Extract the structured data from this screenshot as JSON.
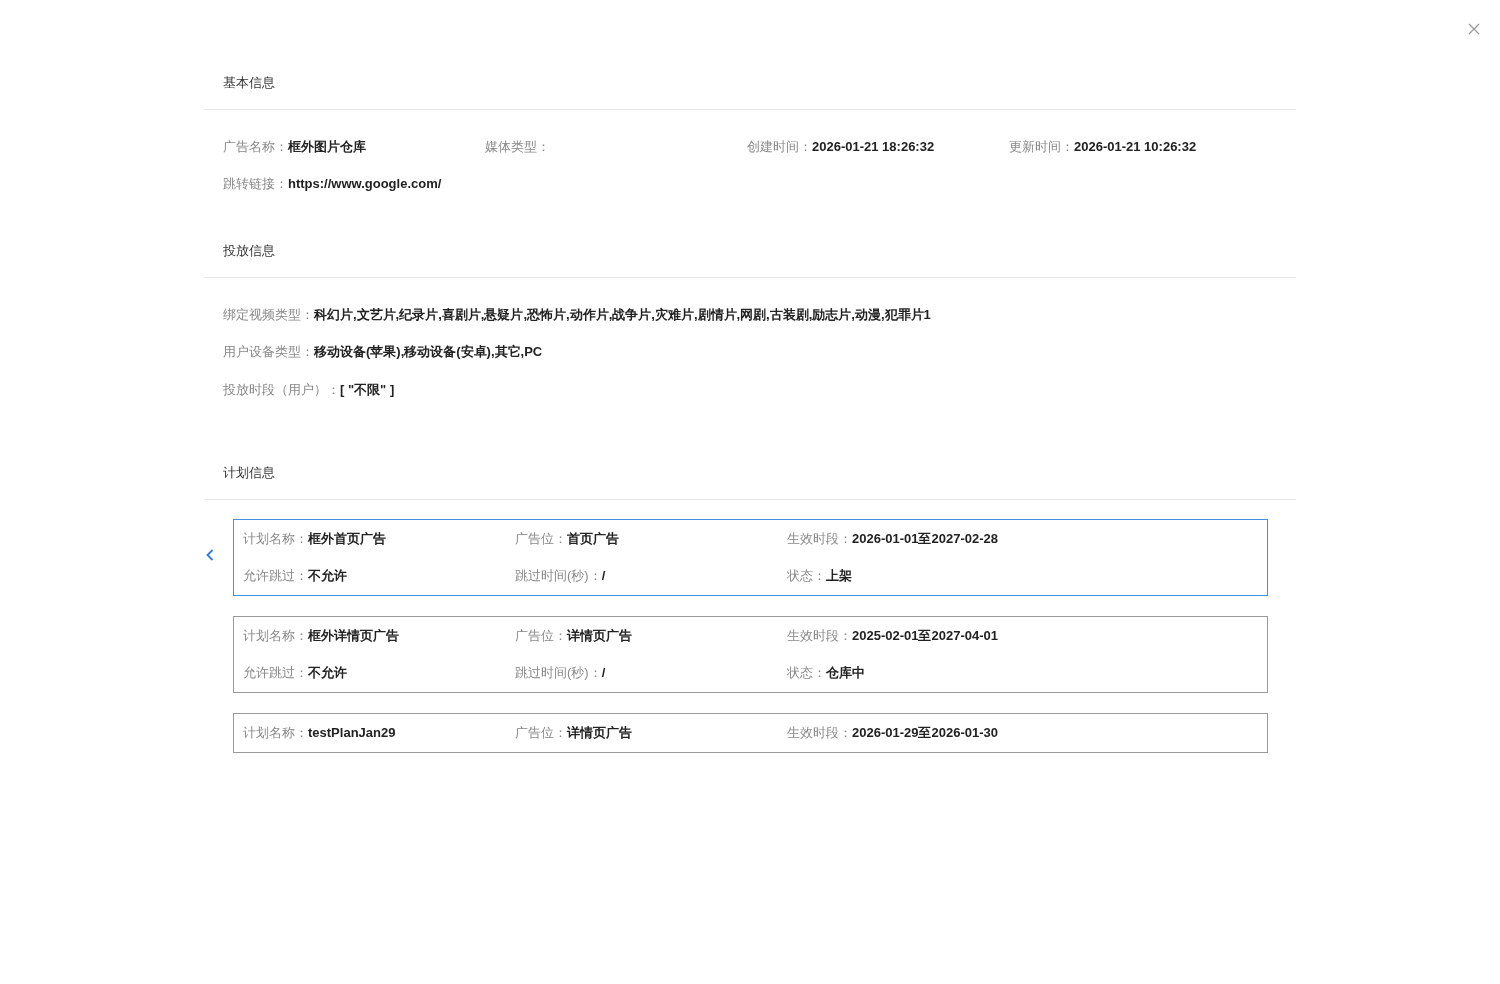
{
  "sections": [
    {
      "title": "基本信息",
      "kind": "fields",
      "rows": [
        [
          {
            "label": "广告名称：",
            "value": "框外图片仓库"
          },
          {
            "label": "媒体类型："
          },
          {
            "label": "创建时间：",
            "value": "2026-01-21 18:26:32"
          },
          {
            "label": "更新时间：",
            "value": "2026-01-21 10:26:32"
          }
        ],
        [
          {
            "label": "跳转链接：",
            "value": "https://www.google.com/"
          }
        ]
      ]
    },
    {
      "title": "投放信息",
      "kind": "fields",
      "rows": [
        [
          {
            "label": "绑定视频类型：",
            "value": "科幻片,文艺片,纪录片,喜剧片,悬疑片,恐怖片,动作片,战争片,灾难片,剧情片,网剧,古装剧,励志片,动漫,犯罪片1"
          }
        ],
        [
          {
            "label": "用户设备类型：",
            "value": "移动设备(苹果),移动设备(安卓),其它,PC"
          }
        ],
        [
          {
            "label": "投放时段（用户）：",
            "value": "[ \"不限\" ]"
          }
        ]
      ]
    },
    {
      "title": "计划信息",
      "kind": "plans",
      "plans": [
        {
          "selected": true,
          "rows": [
            [
              {
                "label": "计划名称：",
                "value": "框外首页广告"
              },
              {
                "label": "广告位：",
                "value": "首页广告"
              },
              {
                "label": "生效时段：",
                "value": "2026-01-01至2027-02-28"
              }
            ],
            [
              {
                "label": "允许跳过：",
                "value": "不允许"
              },
              {
                "label": "跳过时间(秒)：",
                "value": "/"
              },
              {
                "label": "状态：",
                "value": "上架"
              }
            ]
          ]
        },
        {
          "selected": false,
          "rows": [
            [
              {
                "label": "计划名称：",
                "value": "框外详情页广告"
              },
              {
                "label": "广告位：",
                "value": "详情页广告"
              },
              {
                "label": "生效时段：",
                "value": "2025-02-01至2027-04-01"
              }
            ],
            [
              {
                "label": "允许跳过：",
                "value": "不允许"
              },
              {
                "label": "跳过时间(秒)：",
                "value": "/"
              },
              {
                "label": "状态：",
                "value": "仓库中"
              }
            ]
          ]
        },
        {
          "selected": false,
          "rows": [
            [
              {
                "label": "计划名称：",
                "value": "testPlanJan29"
              },
              {
                "label": "广告位：",
                "value": "详情页广告"
              },
              {
                "label": "生效时段：",
                "value": "2026-01-29至2026-01-30"
              }
            ]
          ]
        }
      ]
    }
  ]
}
